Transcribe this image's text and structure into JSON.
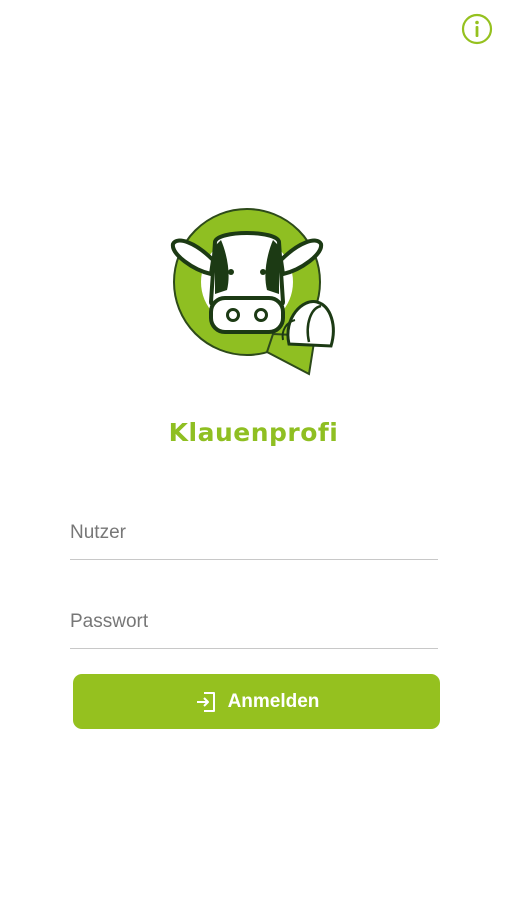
{
  "app": {
    "title": "Klauenprofi",
    "accent_color": "#95c11f",
    "logo_icon": "cow-hoof-q-logo"
  },
  "header": {
    "info_icon": "info-icon"
  },
  "login": {
    "user_placeholder": "Nutzer",
    "user_value": "",
    "password_placeholder": "Passwort",
    "password_value": "",
    "submit_label": "Anmelden",
    "submit_icon": "login-arrow-icon"
  }
}
